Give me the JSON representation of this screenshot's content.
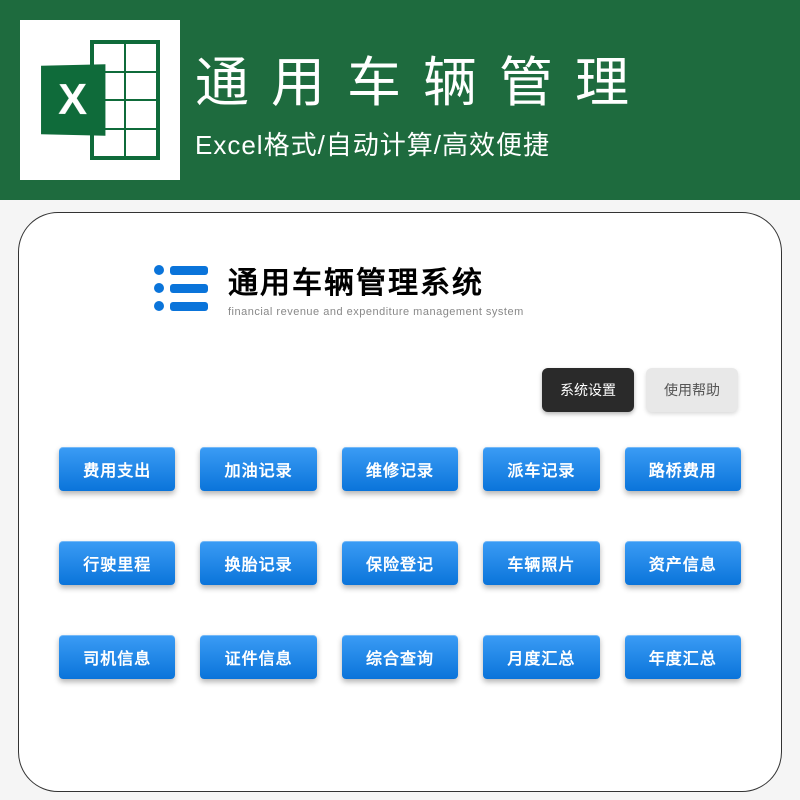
{
  "banner": {
    "title": "通用车辆管理",
    "subtitle": "Excel格式/自动计算/高效便捷",
    "icon_letter": "X"
  },
  "system": {
    "title": "通用车辆管理系统",
    "subtitle": "financial revenue and expenditure management system"
  },
  "top_buttons": {
    "settings": "系统设置",
    "help": "使用帮助"
  },
  "menu": {
    "items": [
      "费用支出",
      "加油记录",
      "维修记录",
      "派车记录",
      "路桥费用",
      "行驶里程",
      "换胎记录",
      "保险登记",
      "车辆照片",
      "资产信息",
      "司机信息",
      "证件信息",
      "综合查询",
      "月度汇总",
      "年度汇总"
    ]
  }
}
